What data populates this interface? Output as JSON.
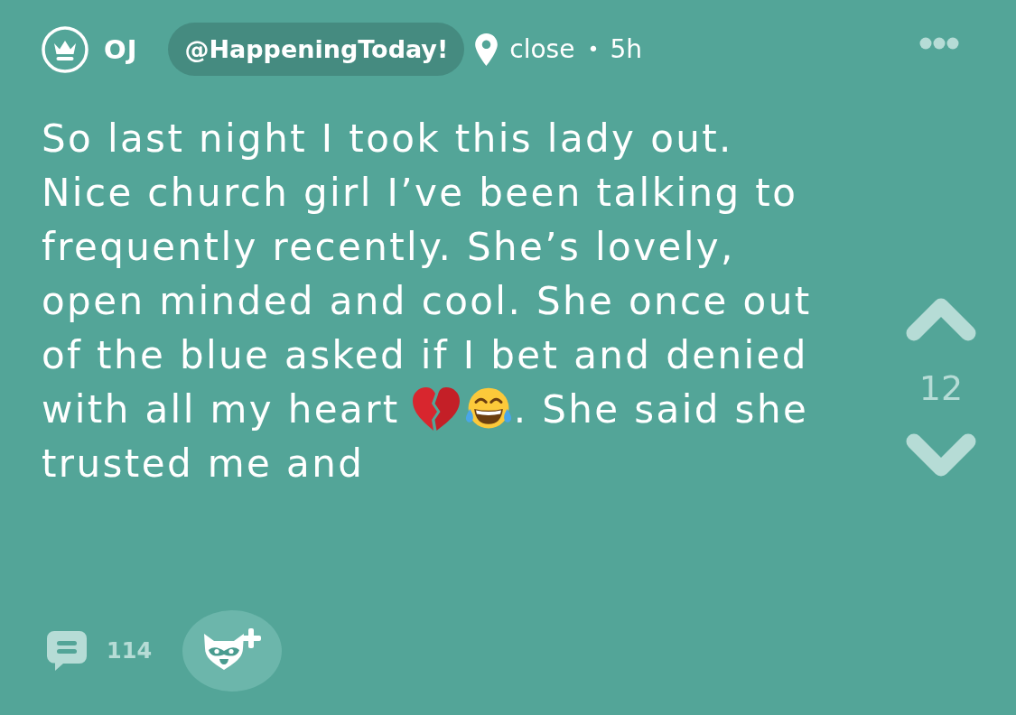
{
  "post": {
    "author": {
      "name": "OJ"
    },
    "channel": "@HappeningToday!",
    "location": "close",
    "separator": "•",
    "age": "5h",
    "lines": [
      [
        {
          "kind": "text",
          "text": "So last night I took this lady out."
        }
      ],
      [
        {
          "kind": "text",
          "text": "Nice church girl I’ve been talking to"
        }
      ],
      [
        {
          "kind": "text",
          "text": "frequently recently. She’s lovely,"
        }
      ],
      [
        {
          "kind": "text",
          "text": "open minded and cool. She once out"
        }
      ],
      [
        {
          "kind": "text",
          "text": "of the blue asked if I bet and denied"
        }
      ],
      [
        {
          "kind": "text",
          "text": "with all my heart"
        },
        {
          "kind": "broken-heart"
        },
        {
          "kind": "tears-of-joy"
        },
        {
          "kind": "text",
          "text": ". She said she"
        }
      ],
      [
        {
          "kind": "text",
          "text": "trusted me and"
        }
      ]
    ],
    "votes": "12",
    "comments": "114"
  }
}
